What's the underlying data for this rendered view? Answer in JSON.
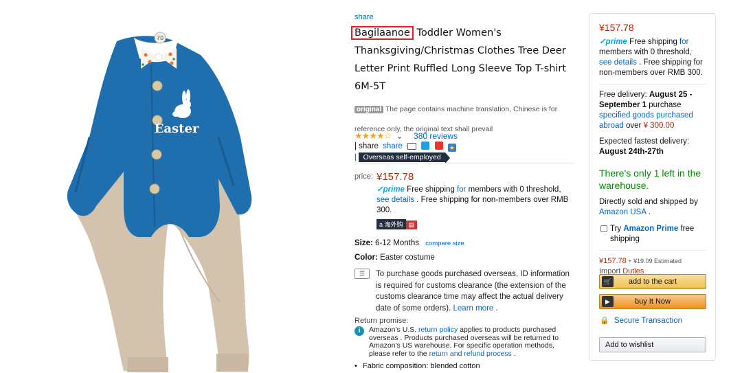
{
  "product": {
    "share_top": "share",
    "brand": "Bagilaanoe",
    "title_rest": " Toddler Women's Thanksgiving/Christmas Clothes Tree Deer Letter Print Ruffled Long Sleeve Top T-shirt 6M-5T",
    "original_badge": "original",
    "translation_note": "The page contains machine translation, Chinese is for reference only, the original text shall prevail",
    "rating_stars": "★★★★☆",
    "rating_chevron": "⌄",
    "reviews": "380 reviews",
    "share_row_prefix": "| share",
    "share_row_link": "share",
    "seller_tag_prefix": "|",
    "seller_tag": "Overseas self-employed",
    "image_label": "Easter",
    "image_tag_num": "70"
  },
  "price_block": {
    "label": "price:",
    "value": "¥157.78",
    "prime": "prime",
    "shipping_1": "Free shipping ",
    "shipping_for": "for",
    "shipping_2": " members with 0 threshold,",
    "see_details": "see details",
    "shipping_3": " . Free shipping for non-members over RMB 300.",
    "hw_tag": "a 海外购"
  },
  "size": {
    "label": "Size:",
    "value": "6-12 Months",
    "compare": "compare size"
  },
  "color": {
    "label": "Color:",
    "value": "Easter costume"
  },
  "customs": {
    "text": "To purchase goods purchased overseas, ID information is required for customs clearance (the extension of the customs clearance time may affect the actual delivery date of some orders).",
    "learn_more": "Learn more",
    "end": " ."
  },
  "returns": {
    "label": "Return promise:",
    "text_1": "Amazon's U.S. ",
    "policy": "return policy",
    "text_2": " applies to products purchased overseas . Products purchased overseas will be returned to Amazon's US warehouse. For specific operation methods, please refer to the ",
    "process": "return and refund process",
    "text_3": " ."
  },
  "features": [
    "Fabric composition: blended cotton"
  ],
  "buy_box": {
    "price": "¥157.78",
    "prime": "prime",
    "ship_1": " Free shipping ",
    "ship_for": "for",
    "ship_2": " members with 0 threshold, ",
    "ship_see": "see details",
    "ship_3": " . Free shipping for non-members over RMB 300.",
    "delivery_1": "Free delivery: ",
    "delivery_dates": "August 25 - September 1",
    "delivery_2": " purchase ",
    "delivery_link": "specified goods purchased abroad",
    "delivery_3": " over ",
    "delivery_amount": "¥ 300.00",
    "fastest_label": "Expected fastest delivery:",
    "fastest_dates": "August 24th-27th",
    "stock": "There's only 1 left in the warehouse.",
    "sold_by": "Directly sold and shipped by ",
    "sold_by_link": "Amazon USA",
    "sold_by_end": " .",
    "try_1": "Try ",
    "try_prime": "Amazon Prime",
    "try_2": " free shipping",
    "price_2": "¥157.78",
    "estimated": " + ¥19.09 Estimated",
    "import": "Import ",
    "duties": "Duties",
    "add_to_cart": "add to the cart",
    "buy_now": "buy It Now",
    "secure": "Secure Transaction",
    "wishlist": "Add to wishlist"
  },
  "colors": {
    "price_red": "#b12704",
    "link_blue": "#0066c0",
    "prime_blue": "#00a8e1",
    "stock_green": "#008a00",
    "onesie_blue": "#1f6fae",
    "pants_khaki": "#d3c2ad"
  }
}
